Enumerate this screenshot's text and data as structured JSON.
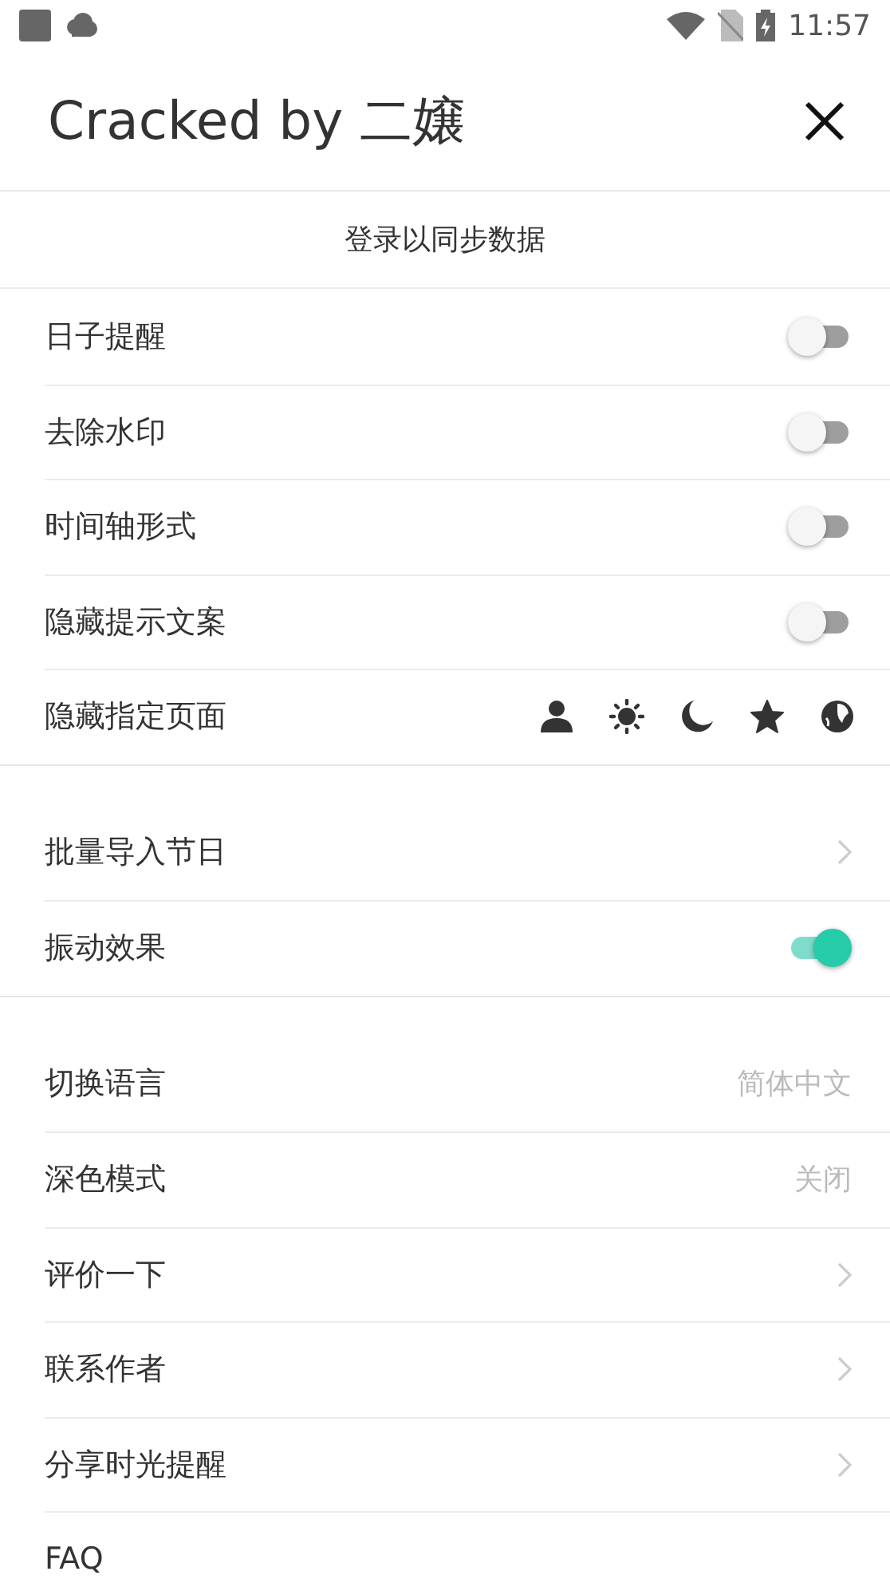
{
  "status_bar": {
    "time": "11:57"
  },
  "header": {
    "title": "Cracked by 二嬢"
  },
  "sign_in": {
    "label": "登录以同步数据"
  },
  "sections": [
    {
      "items": [
        {
          "kind": "toggle",
          "label": "日子提醒",
          "on": false
        },
        {
          "kind": "toggle",
          "label": "去除水印",
          "on": false
        },
        {
          "kind": "toggle",
          "label": "时间轴形式",
          "on": false
        },
        {
          "kind": "toggle",
          "label": "隐藏提示文案",
          "on": false
        },
        {
          "kind": "icons",
          "label": "隐藏指定页面"
        }
      ]
    },
    {
      "items": [
        {
          "kind": "link",
          "label": "批量导入节日"
        },
        {
          "kind": "toggle",
          "label": "振动效果",
          "on": true
        }
      ]
    },
    {
      "items": [
        {
          "kind": "value",
          "label": "切换语言",
          "value": "简体中文"
        },
        {
          "kind": "value",
          "label": "深色模式",
          "value": "关闭"
        },
        {
          "kind": "link",
          "label": "评价一下"
        },
        {
          "kind": "link",
          "label": "联系作者"
        },
        {
          "kind": "link",
          "label": "分享时光提醒"
        },
        {
          "kind": "plain",
          "label": "FAQ"
        }
      ]
    }
  ]
}
